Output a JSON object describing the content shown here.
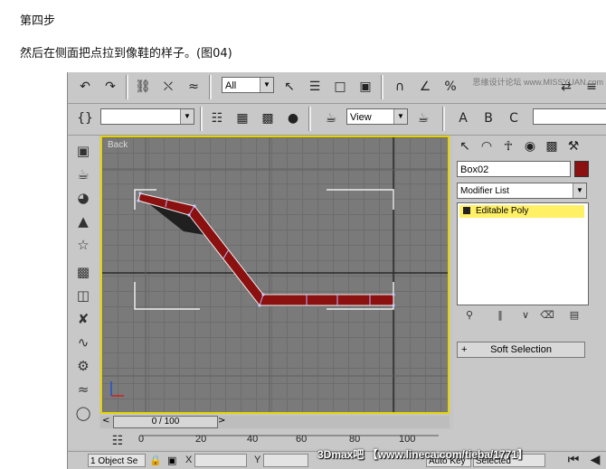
{
  "article": {
    "step_title": "第四步",
    "step_desc": "然后在侧面把点拉到像鞋的样子。(图04)"
  },
  "toolbar1": {
    "selection_filter": "All",
    "watermark": "思缘设计论坛 www.MISSYUAN.com"
  },
  "toolbar2": {
    "named_selection": "",
    "ref_coord": "View"
  },
  "viewport": {
    "label": "Back",
    "mesh_color": "#8b1010",
    "active_border": "#e6d400"
  },
  "command_panel": {
    "object_name": "Box02",
    "object_color": "#8b1010",
    "modifier_list": "Modifier List",
    "stack_item": "Editable Poly",
    "rollout": "Soft Selection"
  },
  "time": {
    "slider": "0 / 100",
    "ticks": [
      "0",
      "20",
      "40",
      "60",
      "80",
      "100"
    ]
  },
  "status": {
    "selection": "1 Object Se",
    "x_label": "X",
    "y_label": "Y",
    "auto_key": "Auto Key",
    "selected": "Selected"
  },
  "credit": "3Dmax吧 【www.lineca.com/tieba/1771】"
}
